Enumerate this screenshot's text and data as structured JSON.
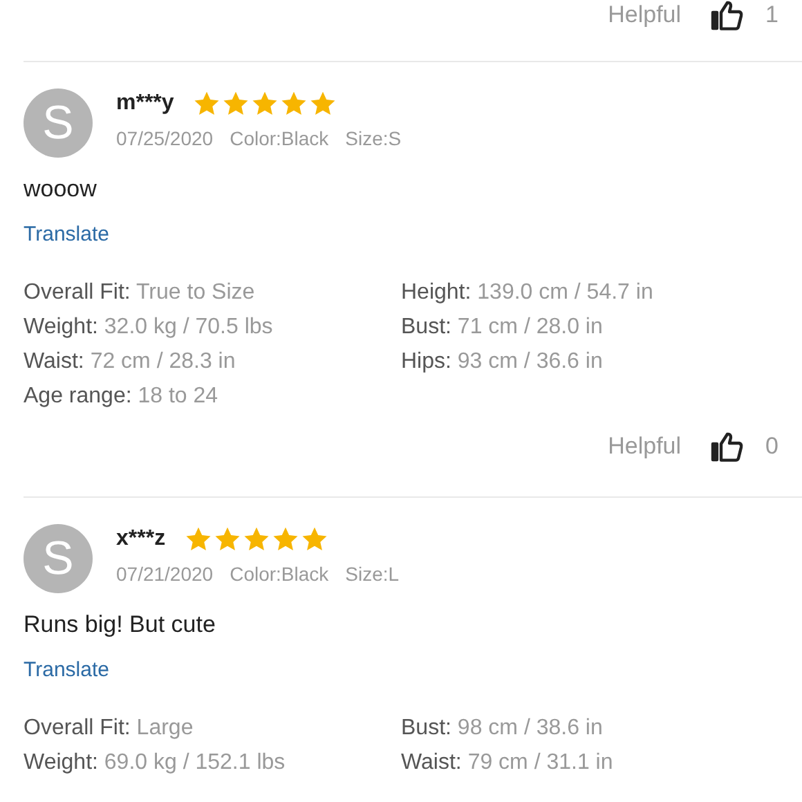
{
  "previous_review_footer": {
    "helpful_label": "Helpful",
    "helpful_count": "1"
  },
  "reviews": [
    {
      "avatar_letter": "S",
      "name": "m***y",
      "stars": 5,
      "date": "07/25/2020",
      "color_option": "Color:Black",
      "size_option": "Size:S",
      "comment": "wooow",
      "translate": "Translate",
      "specs": [
        {
          "label": "Overall Fit:",
          "value": "True to Size"
        },
        {
          "label": "Height:",
          "value": "139.0 cm / 54.7 in"
        },
        {
          "label": "Weight:",
          "value": "32.0 kg / 70.5 lbs"
        },
        {
          "label": "Bust:",
          "value": "71 cm / 28.0 in"
        },
        {
          "label": "Waist:",
          "value": "72 cm / 28.3 in"
        },
        {
          "label": "Hips:",
          "value": "93 cm / 36.6 in"
        },
        {
          "label": "Age range:",
          "value": "18 to 24"
        }
      ],
      "helpful_label": "Helpful",
      "helpful_count": "0"
    },
    {
      "avatar_letter": "S",
      "name": "x***z",
      "stars": 5,
      "date": "07/21/2020",
      "color_option": "Color:Black",
      "size_option": "Size:L",
      "comment": "Runs big! But cute",
      "translate": "Translate",
      "specs": [
        {
          "label": "Overall Fit:",
          "value": "Large"
        },
        {
          "label": "Bust:",
          "value": "98 cm / 38.6 in"
        },
        {
          "label": "Weight:",
          "value": "69.0 kg / 152.1 lbs"
        },
        {
          "label": "Waist:",
          "value": "79 cm / 31.1 in"
        }
      ]
    }
  ]
}
